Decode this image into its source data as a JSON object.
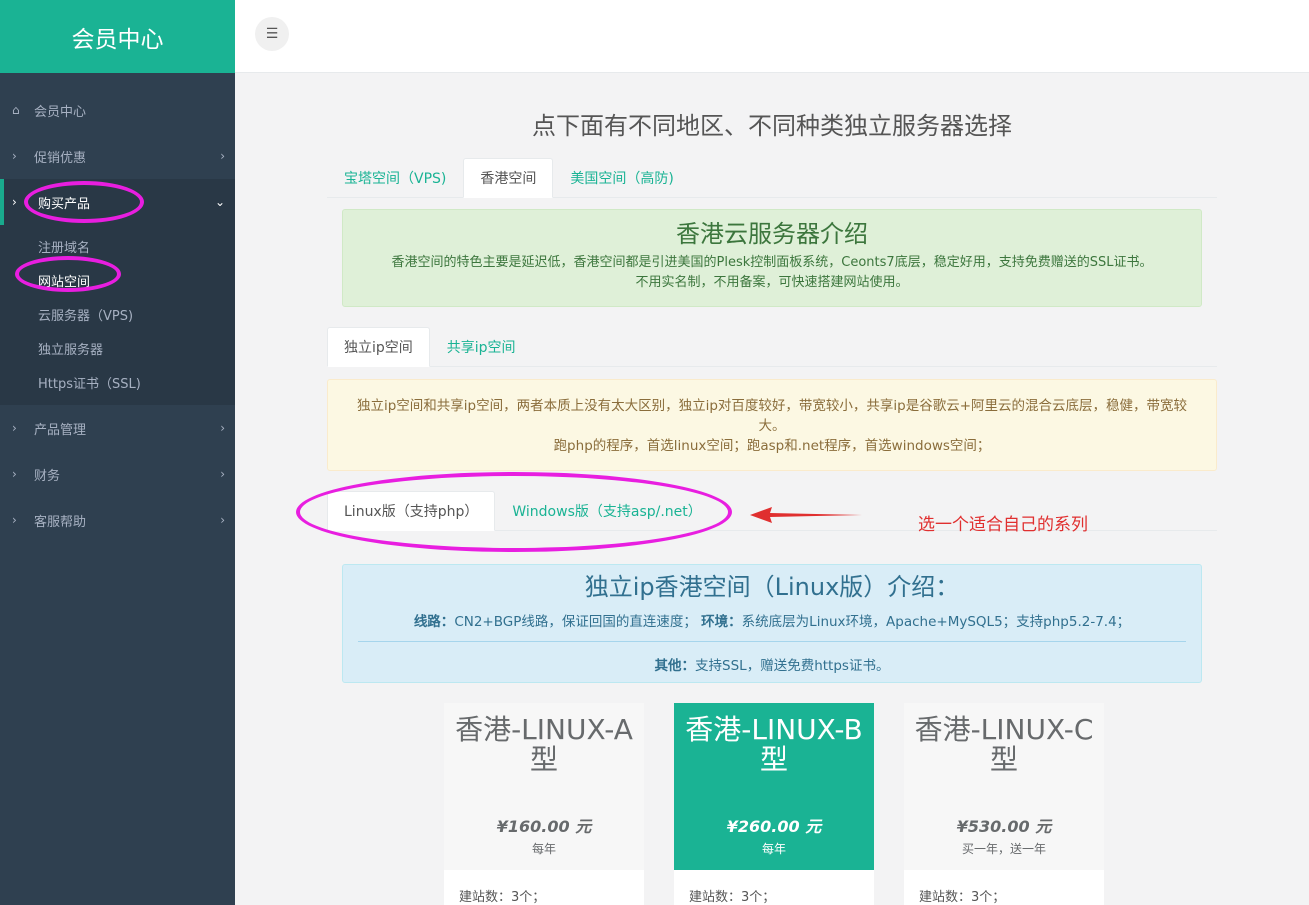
{
  "sidebar": {
    "brand": "会员中心",
    "items": [
      {
        "label": "会员中心",
        "icon": "home-icon"
      },
      {
        "label": "促销优惠",
        "icon": "chevron-right-icon"
      },
      {
        "label": "购买产品",
        "icon": "chevron-right-icon"
      },
      {
        "label": "产品管理",
        "icon": "chevron-right-icon"
      },
      {
        "label": "财务",
        "icon": "chevron-right-icon"
      },
      {
        "label": "客服帮助",
        "icon": "chevron-right-icon"
      }
    ],
    "submenu": [
      "注册域名",
      "网站空间",
      "云服务器（VPS)",
      "独立服务器",
      "Https证书（SSL)"
    ]
  },
  "topbar": {
    "menu_icon": "hamburger-icon"
  },
  "main": {
    "title": "点下面有不同地区、不同种类独立服务器选择",
    "region_tabs": [
      "宝塔空间（VPS)",
      "香港空间",
      "美国空间（高防)"
    ],
    "intro": {
      "title": "香港云服务器介绍",
      "line1": "香港空间的特色主要是延迟低，香港空间都是引进美国的Plesk控制面板系统，Ceonts7底层，稳定好用，支持免费赠送的SSL证书。",
      "line2": "不用实名制，不用备案，可快速搭建网站使用。"
    },
    "ip_tabs": [
      "独立ip空间",
      "共享ip空间"
    ],
    "ip_note": {
      "line1": "独立ip空间和共享ip空间，两者本质上没有太大区别，独立ip对百度较好，带宽较小，共享ip是谷歌云+阿里云的混合云底层，稳健，带宽较大。",
      "line2": "跑php的程序，首选linux空间；跑asp和.net程序，首选windows空间；"
    },
    "os_tabs": [
      "Linux版（支持php）",
      "Windows版（支持asp/.net）"
    ],
    "annotation": "选一个适合自己的系列",
    "linux_intro": {
      "title": "独立ip香港空间（Linux版）介绍：",
      "route_label": "线路：",
      "route_text": "CN2+BGP线路，保证回国的直连速度；",
      "env_label": "环境：",
      "env_text": "系统底层为Linux环境，Apache+MySQL5；支持php5.2-7.4；",
      "other_label": "其他：",
      "other_text": "支持SSL，赠送免费https证书。"
    },
    "plans": [
      {
        "name": "香港-LINUX-A型",
        "price": "¥160.00 元",
        "period": "每年",
        "feature": "建站数：3个；"
      },
      {
        "name": "香港-LINUX-B型",
        "price": "¥260.00 元",
        "period": "每年",
        "feature": "建站数：3个；"
      },
      {
        "name": "香港-LINUX-C型",
        "price": "¥530.00 元",
        "period": "买一年，送一年",
        "feature": "建站数：3个；"
      }
    ]
  },
  "colors": {
    "accent": "#1ab394",
    "sidebar": "#2f4050",
    "highlight_ring": "#e81ee0",
    "annotation": "#e02f2f"
  }
}
